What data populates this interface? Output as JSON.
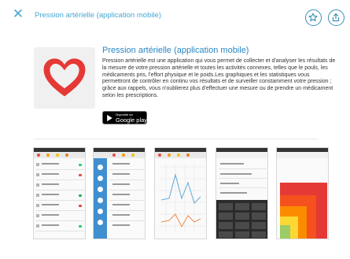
{
  "header": {
    "close_icon": "close-icon",
    "title": "Pression artérielle (application mobile)",
    "favorite_icon": "star-icon",
    "share_icon": "share-icon",
    "accent_color": "#47a8d1"
  },
  "app": {
    "name": "Pression artérielle (application mobile)",
    "icon": "heart-icon",
    "description": "Pression artérielle est une application qui vous permet de collecter et d'analyser les résultats de la mesure de votre pression artérielle et toutes les activités connexes, telles que le pouls, les médicaments pris, l'effort physique et le poids.Les graphiques et les statistiques vous permettront de contrôler en continu vos résultats et de surveiller constamment votre pression ; grâce aux rappels, vous n'oublierez plus d'effectuer une mesure ou de prendre un médicament selon les prescriptions.",
    "store_badge": {
      "small_text": "Disponible sur",
      "big_text": "Google play",
      "icon": "google-play-icon"
    },
    "name_color": "#2a87c4",
    "heart_color": "#e53935"
  },
  "screenshots": [
    {
      "label": "screenshot-list"
    },
    {
      "label": "screenshot-menu"
    },
    {
      "label": "screenshot-chart"
    },
    {
      "label": "screenshot-keypad"
    },
    {
      "label": "screenshot-heatmap"
    }
  ]
}
